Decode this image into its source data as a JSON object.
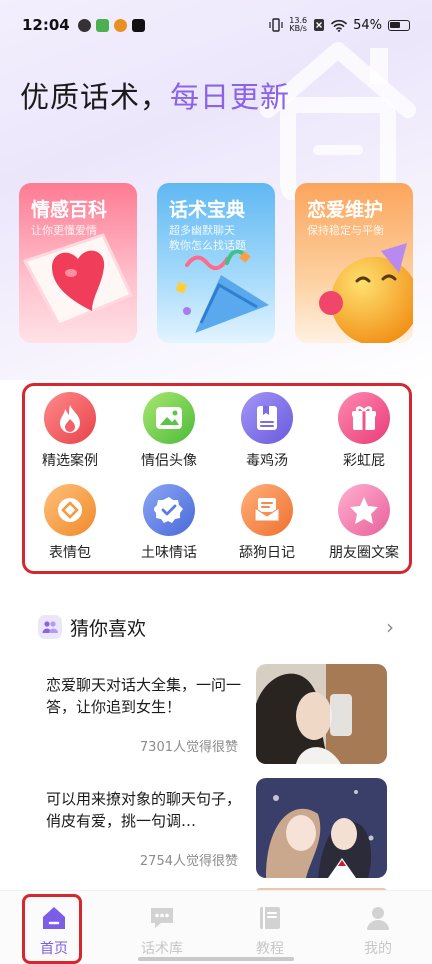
{
  "status_bar": {
    "time": "12:04",
    "net_speed_value": "13.6",
    "net_speed_unit": "KB/s",
    "battery": "54%"
  },
  "header": {
    "title_main": "优质话术，",
    "title_accent": "每日更新"
  },
  "cards": [
    {
      "title": "情感百科",
      "subtitle": "让你更懂爱情",
      "icon": "heart-icon"
    },
    {
      "title": "话术宝典",
      "subtitle_line1": "超多幽默聊天",
      "subtitle_line2": "教你怎么找话题",
      "icon": "party-popper-icon"
    },
    {
      "title": "恋爱维护",
      "subtitle": "保持稳定与平衡",
      "icon": "party-face-icon"
    }
  ],
  "grid": [
    {
      "label": "精选案例",
      "icon": "flame-icon",
      "color": "#f25c5c"
    },
    {
      "label": "情侣头像",
      "icon": "image-icon",
      "color": "#6ccf4e"
    },
    {
      "label": "毒鸡汤",
      "icon": "book-icon",
      "color": "#7b6ce8"
    },
    {
      "label": "彩虹屁",
      "icon": "gift-icon",
      "color": "#f0558a"
    },
    {
      "label": "表情包",
      "icon": "sticker-icon",
      "color": "#f59a3d"
    },
    {
      "label": "土味情话",
      "icon": "badge-check-icon",
      "color": "#5b7ce8"
    },
    {
      "label": "舔狗日记",
      "icon": "mail-icon",
      "color": "#f58a4a"
    },
    {
      "label": "朋友圈文案",
      "icon": "star-icon",
      "color": "#f07aa8"
    }
  ],
  "section": {
    "title": "猜你喜欢",
    "arrow": "›"
  },
  "articles": [
    {
      "title": "恋爱聊天对话大全集，一问一答，让你追到女生！",
      "likes": "7301人觉得很赞"
    },
    {
      "title": "可以用来撩对象的聊天句子，俏皮有爱，挑一句调…",
      "likes": "2754人觉得很赞"
    }
  ],
  "tabs": [
    {
      "label": "首页",
      "icon": "home-icon",
      "active": true
    },
    {
      "label": "话术库",
      "icon": "chat-icon",
      "active": false
    },
    {
      "label": "教程",
      "icon": "book-icon",
      "active": false
    },
    {
      "label": "我的",
      "icon": "user-icon",
      "active": false
    }
  ],
  "colors": {
    "accent": "#8a63e6",
    "annotation_red": "#d6262e",
    "tab_active": "#7b5ee8",
    "tab_inactive": "#c7c7c7"
  }
}
